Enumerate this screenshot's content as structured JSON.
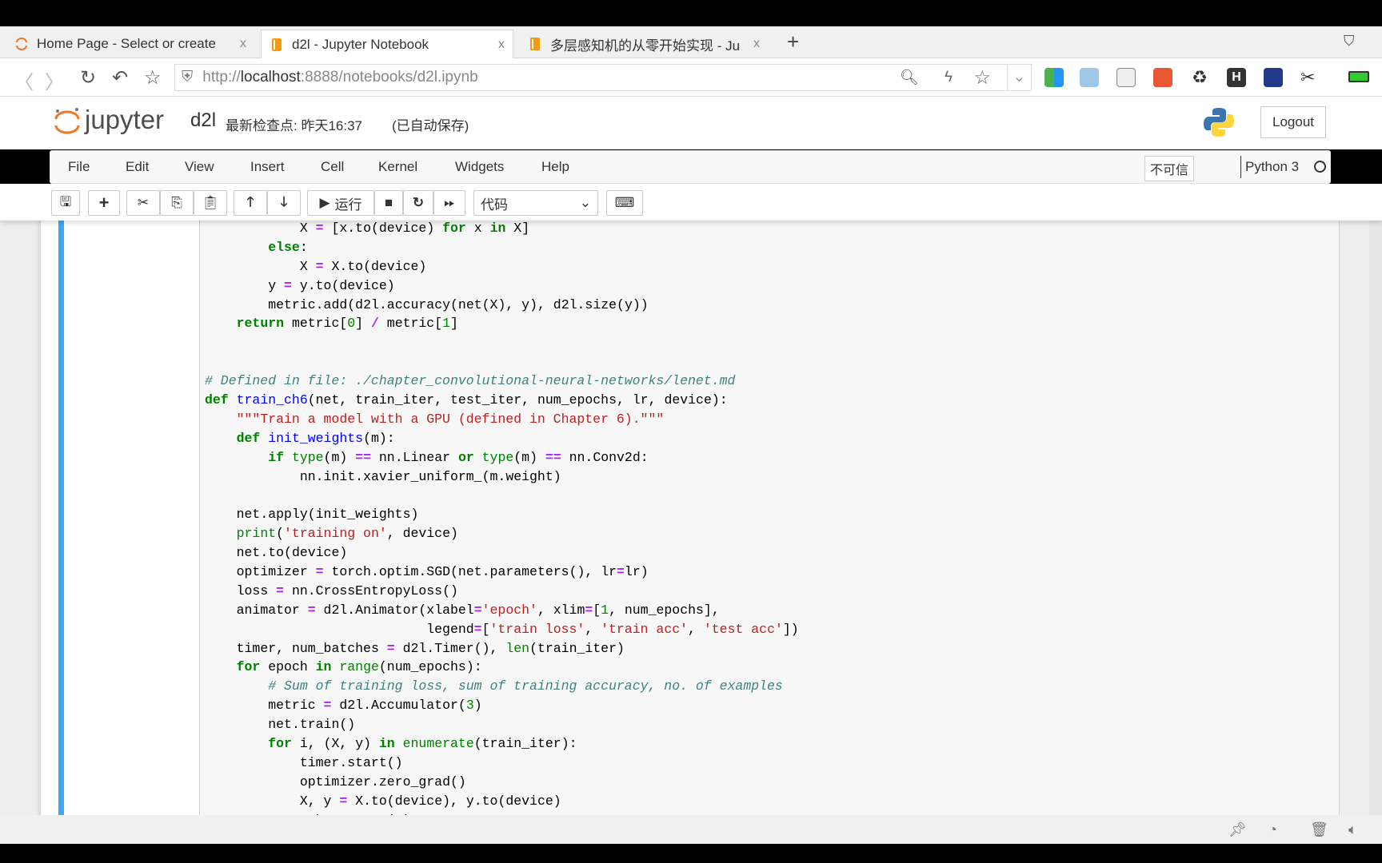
{
  "tabs": [
    {
      "title": "Home Page - Select or create",
      "icon": "jupyter-icon"
    },
    {
      "title": "d2l - Jupyter Notebook",
      "icon": "notebook-icon",
      "active": true
    },
    {
      "title": "多层感知机的从零开始实现 - Ju",
      "icon": "notebook-icon"
    }
  ],
  "tab_close": "x",
  "new_tab": "+",
  "address": {
    "prefix": "http://",
    "host": "localhost",
    "rest": ":8888/notebooks/d2l.ipynb"
  },
  "header": {
    "logo_text": "jupyter",
    "notebook_name": "d2l",
    "checkpoint": "最新检查点: 昨天16:37",
    "autosave": "(已自动保存)",
    "logout": "Logout"
  },
  "menu": [
    "File",
    "Edit",
    "View",
    "Insert",
    "Cell",
    "Kernel",
    "Widgets",
    "Help"
  ],
  "trusted": "不可信",
  "kernel": "Python 3",
  "toolbar": {
    "run_label": "运行",
    "cell_type": "代码"
  },
  "code_lines": [
    "            X = [x.to(device) for x in X]",
    "        else:",
    "            X = X.to(device)",
    "        y = y.to(device)",
    "        metric.add(d2l.accuracy(net(X), y), d2l.size(y))",
    "    return metric[0] / metric[1]",
    "",
    "",
    "# Defined in file: ./chapter_convolutional-neural-networks/lenet.md",
    "def train_ch6(net, train_iter, test_iter, num_epochs, lr, device):",
    "    \"\"\"Train a model with a GPU (defined in Chapter 6).\"\"\"",
    "    def init_weights(m):",
    "        if type(m) == nn.Linear or type(m) == nn.Conv2d:",
    "            nn.init.xavier_uniform_(m.weight)",
    "",
    "    net.apply(init_weights)",
    "    print('training on', device)",
    "    net.to(device)",
    "    optimizer = torch.optim.SGD(net.parameters(), lr=lr)",
    "    loss = nn.CrossEntropyLoss()",
    "    animator = d2l.Animator(xlabel='epoch', xlim=[1, num_epochs],",
    "                            legend=['train loss', 'train acc', 'test acc'])",
    "    timer, num_batches = d2l.Timer(), len(train_iter)",
    "    for epoch in range(num_epochs):",
    "        # Sum of training loss, sum of training accuracy, no. of examples",
    "        metric = d2l.Accumulator(3)",
    "        net.train()",
    "        for i, (X, y) in enumerate(train_iter):",
    "            timer.start()",
    "            optimizer.zero_grad()",
    "            X, y = X.to(device), y.to(device)",
    "            y_hat = net(X)"
  ],
  "colors": {
    "cell_selected": "#42a5f5",
    "jupyter_orange": "#f37626"
  }
}
